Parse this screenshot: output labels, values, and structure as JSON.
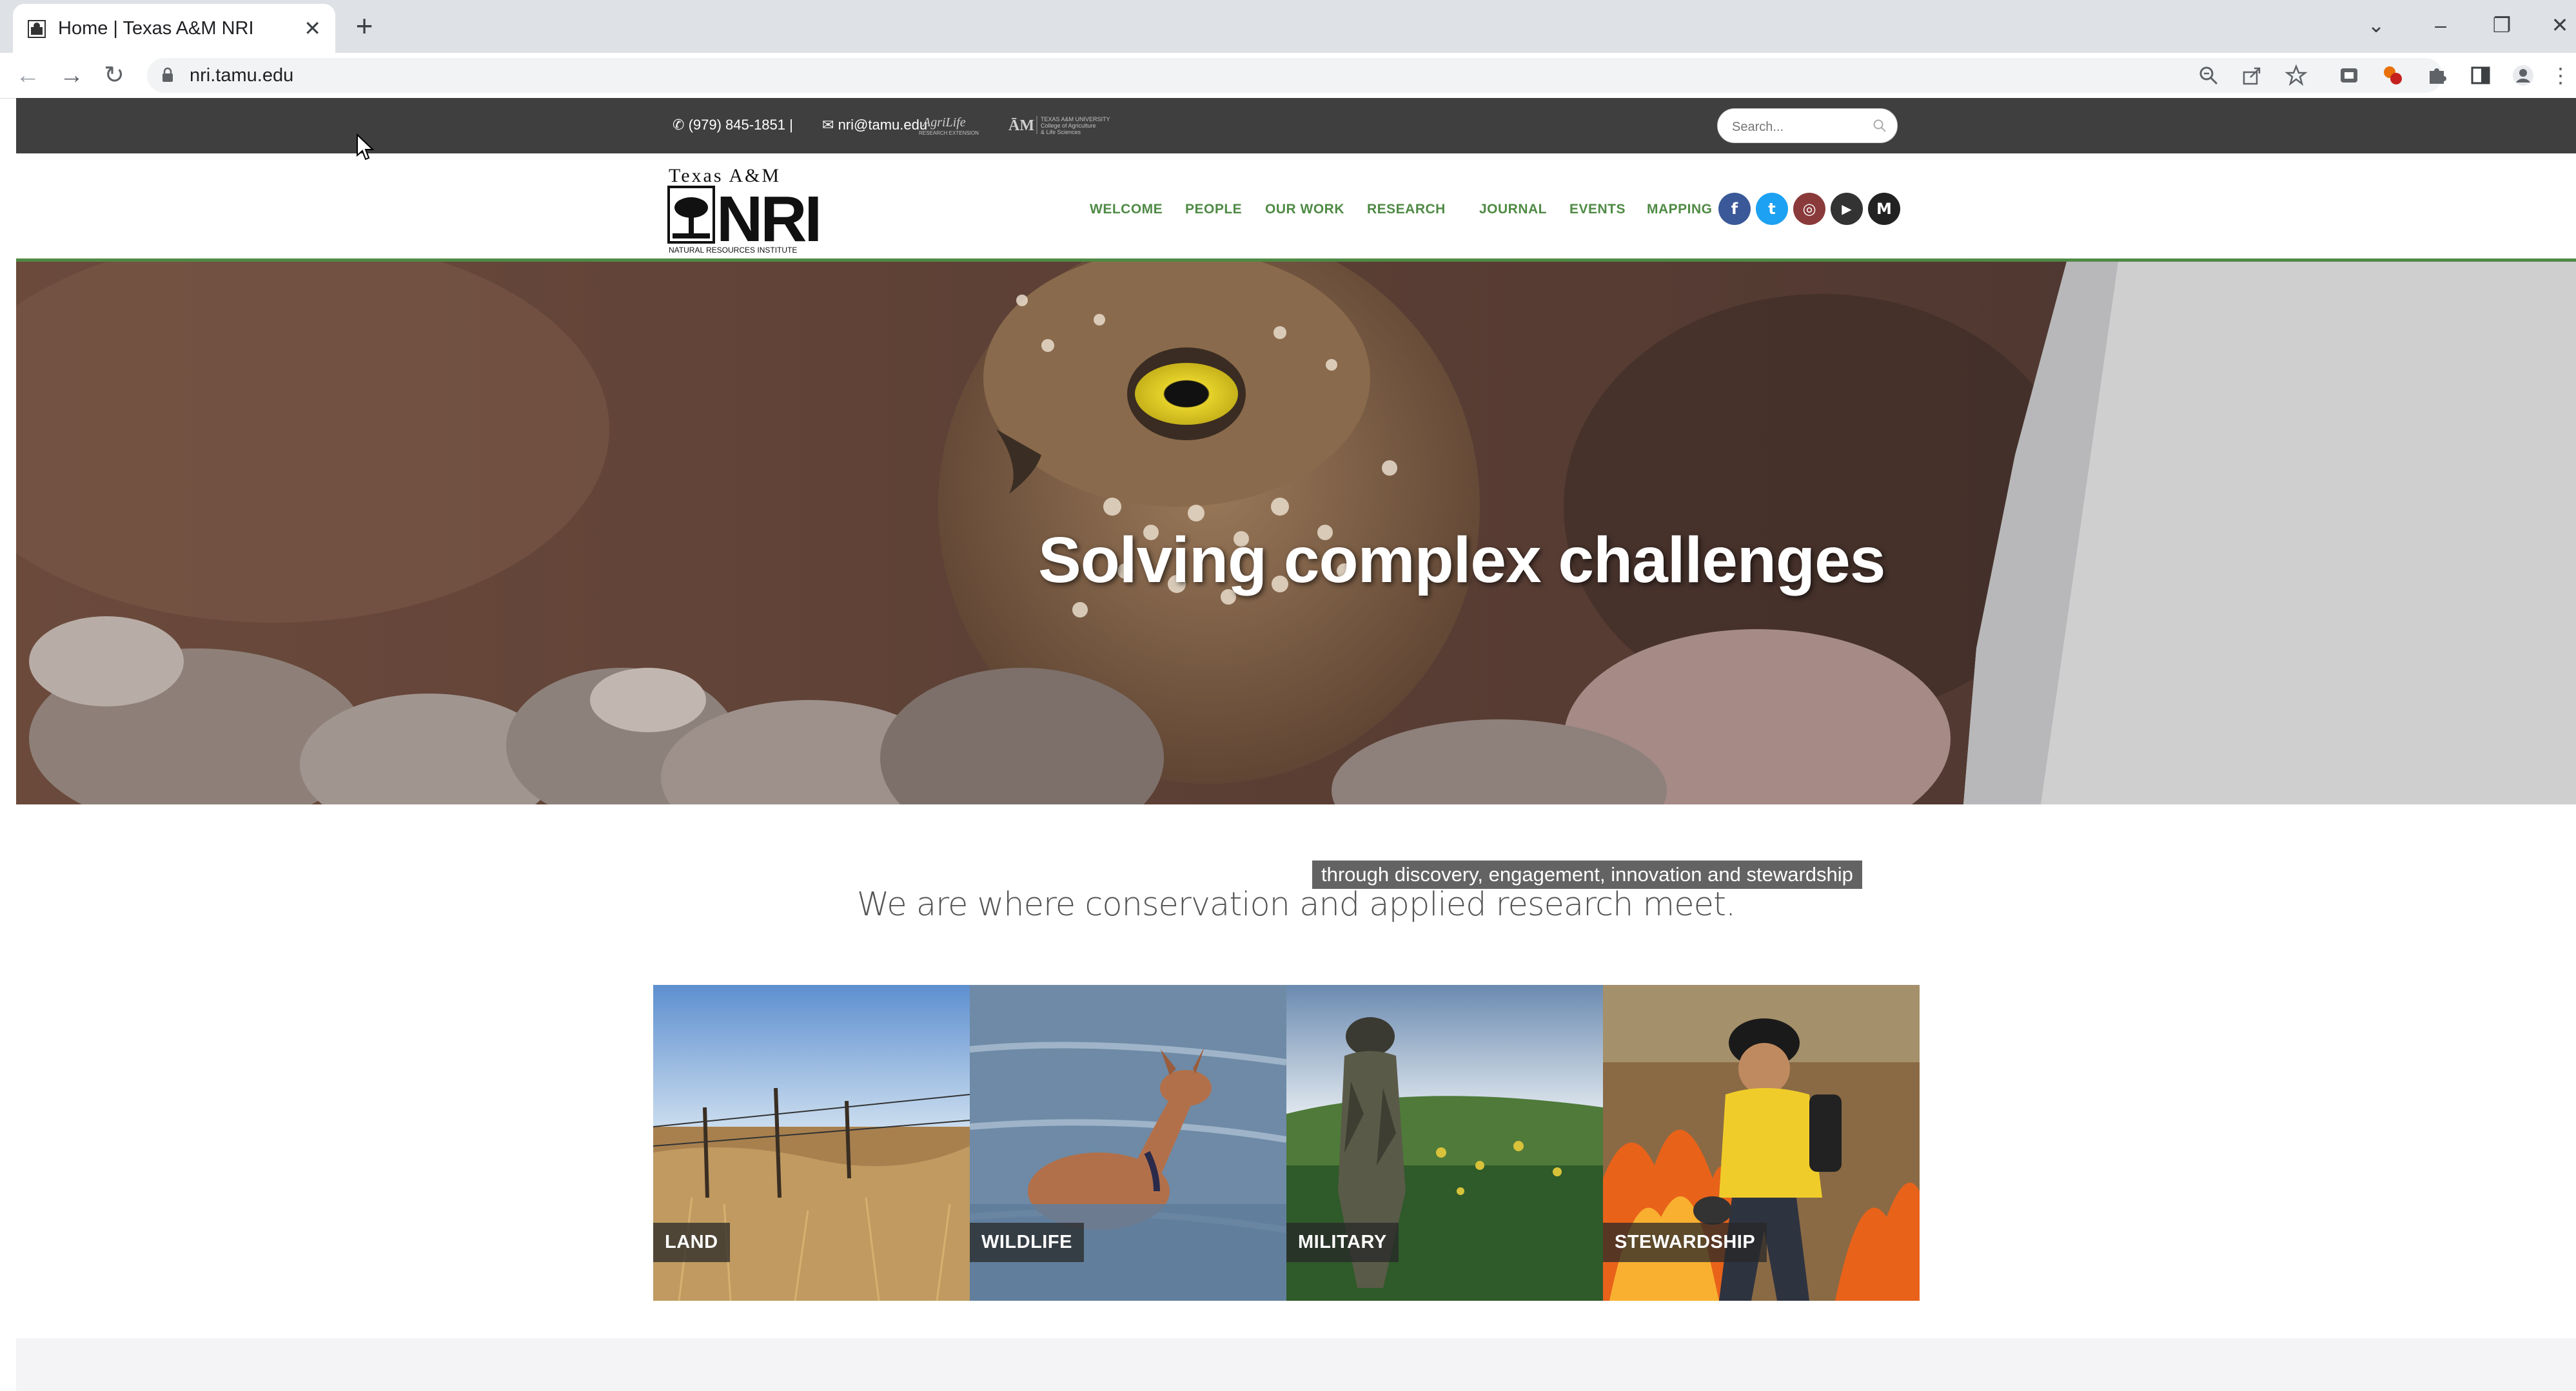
{
  "browser": {
    "tab_title": "Home | Texas A&M NRI",
    "url": "nri.tamu.edu",
    "icons": [
      "back-icon",
      "forward-icon",
      "reload-icon",
      "lock-icon",
      "zoom-icon",
      "share-icon",
      "bookmark-star-icon",
      "extension-icon",
      "puzzle-icon",
      "side-panel-icon",
      "profile-icon",
      "menu-icon"
    ]
  },
  "topbar": {
    "phone": "(979) 845-1851 |",
    "email": "nri@tamu.edu",
    "agrilife_logo": "AgriLife Research Extension",
    "college_logo": "College of Agriculture & Life Sciences",
    "search_placeholder": "Search..."
  },
  "header": {
    "logo_top": "Texas A&M",
    "logo_main": "NRI",
    "logo_sub": "NATURAL RESOURCES INSTITUTE",
    "nav": [
      "WELCOME",
      "PEOPLE",
      "OUR WORK",
      "RESEARCH",
      "JOURNAL",
      "EVENTS",
      "MAPPING"
    ],
    "social": [
      {
        "name": "facebook-icon",
        "glyph": "f",
        "color": "#3b5998"
      },
      {
        "name": "twitter-icon",
        "glyph": "t",
        "color": "#1da1f2"
      },
      {
        "name": "instagram-icon",
        "glyph": "◎",
        "color": "#8a3a3a"
      },
      {
        "name": "youtube-icon",
        "glyph": "▶",
        "color": "#333333"
      },
      {
        "name": "medium-icon",
        "glyph": "M",
        "color": "#222222"
      }
    ]
  },
  "hero": {
    "title": "Solving complex challenges",
    "subtitle": "through discovery, engagement, innovation and stewardship"
  },
  "main": {
    "tagline": "We are where conservation and applied research meet.",
    "tiles": [
      {
        "label": "LAND"
      },
      {
        "label": "WILDLIFE"
      },
      {
        "label": "MILITARY"
      },
      {
        "label": "STEWARDSHIP"
      }
    ]
  }
}
